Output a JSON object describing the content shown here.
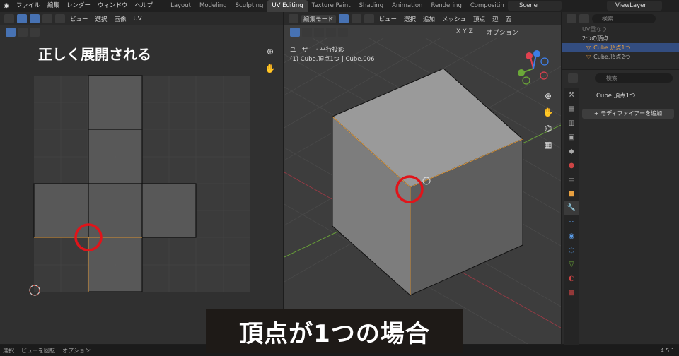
{
  "menu": [
    "ファイル",
    "編集",
    "レンダー",
    "ウィンドウ",
    "ヘルプ"
  ],
  "workspaces": [
    "Layout",
    "Modeling",
    "Sculpting",
    "UV Editing",
    "Texture Paint",
    "Shading",
    "Animation",
    "Rendering",
    "Compositin"
  ],
  "active_workspace": "UV Editing",
  "scene": "Scene",
  "view_layer": "ViewLayer",
  "uv_editor": {
    "menu": [
      "ビュー",
      "選択",
      "画像",
      "UV"
    ],
    "annotation": "正しく展開される"
  },
  "viewport": {
    "mode": "編集モード",
    "menu": [
      "ビュー",
      "選択",
      "追加",
      "メッシュ",
      "頂点",
      "辺",
      "面"
    ],
    "axes": [
      "X",
      "Y",
      "Z"
    ],
    "options": "オプション",
    "view_name": "ユーザー・平行投影",
    "object_info": "(1) Cube.頂点1つ | Cube.006"
  },
  "outliner": {
    "search_placeholder": "検索",
    "items": [
      "UV重なり",
      "2つの頂点",
      "Cube.頂点1つ",
      "Cube.頂点2つ"
    ]
  },
  "properties": {
    "search_placeholder": "検索",
    "object_name": "Cube.頂点1つ",
    "add_modifier": "+ モディファイアーを追加"
  },
  "status": {
    "select": "選択",
    "rotate": "ビューを回転",
    "options": "オプション",
    "version": "4.5.1"
  },
  "banner": "頂点が1つの場合",
  "colors": {
    "accent": "#4772b3",
    "highlight_circle": "#e0141a",
    "selected_edge": "#e8a040",
    "x_axis": "#e0414f",
    "y_axis": "#6ba838",
    "z_axis": "#3e7ee6"
  }
}
